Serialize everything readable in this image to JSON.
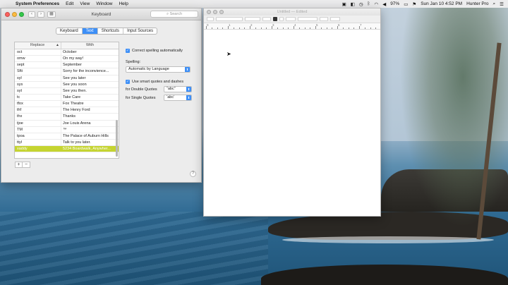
{
  "menubar": {
    "app": "System Preferences",
    "items": [
      "Edit",
      "View",
      "Window",
      "Help"
    ],
    "battery": "97%",
    "datetime": "Sun Jan 10  4:52 PM",
    "user": "Hunter Pro"
  },
  "prefs": {
    "title": "Keyboard",
    "search_placeholder": "Search",
    "tabs": [
      "Keyboard",
      "Text",
      "Shortcuts",
      "Input Sources"
    ],
    "active_tab": "Text",
    "columns": {
      "replace": "Replace",
      "with": "With"
    },
    "rows": [
      {
        "replace": "oct",
        "with": "October"
      },
      {
        "replace": "omw",
        "with": "On my way!"
      },
      {
        "replace": "sept",
        "with": "September"
      },
      {
        "replace": "Sfti",
        "with": "Sorry for the inconvience..."
      },
      {
        "replace": "syl",
        "with": "See you later"
      },
      {
        "replace": "sys",
        "with": "See you soon"
      },
      {
        "replace": "syt",
        "with": "See you then."
      },
      {
        "replace": "tc",
        "with": "Take Care"
      },
      {
        "replace": "tfox",
        "with": "Fox Theatre"
      },
      {
        "replace": "thf",
        "with": "The Henry Ford"
      },
      {
        "replace": "thx",
        "with": "Thanks"
      },
      {
        "replace": "tjoe",
        "with": "Joe Louis Arena"
      },
      {
        "replace": "TM",
        "with": "™"
      },
      {
        "replace": "tpoa",
        "with": "The Palace of Auburn Hills"
      },
      {
        "replace": "ttyl",
        "with": "Talk to you later."
      },
      {
        "replace": "xaddy",
        "with": "5234 Boardwalk, Anywher..."
      }
    ],
    "selected_row": "xaddy",
    "plus": "+",
    "minus": "−",
    "correct_spelling": "Correct spelling automatically",
    "spelling_label": "Spelling:",
    "spelling_value": "Automatic by Language",
    "smart_quotes": "Use smart quotes and dashes",
    "double_quotes_label": "for Double Quotes",
    "double_quotes_value": "“abc”",
    "single_quotes_label": "for Single Quotes",
    "single_quotes_value": "‘abc’",
    "help": "?"
  },
  "textedit": {
    "title": "Untitled — Edited",
    "ruler_numbers": [
      "0",
      "1",
      "2",
      "3",
      "4",
      "5",
      "6",
      "7"
    ]
  },
  "colors": {
    "accent": "#3d8ff7",
    "selection": "#c5d431"
  }
}
